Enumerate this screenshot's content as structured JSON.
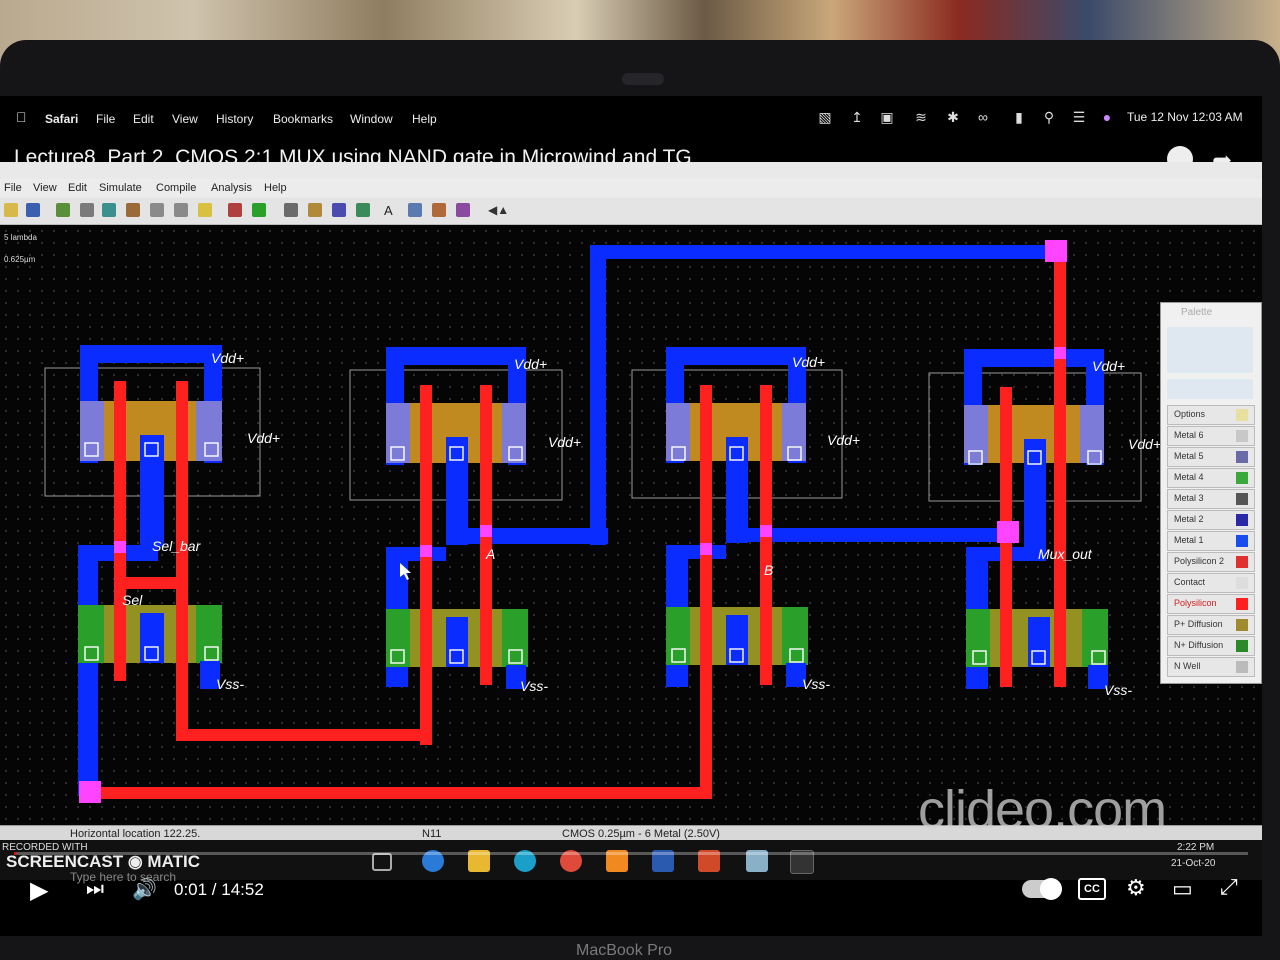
{
  "menubar": {
    "apple": "",
    "app_name": "Safari",
    "items": [
      "File",
      "Edit",
      "View",
      "History",
      "Bookmarks",
      "Window",
      "Help"
    ],
    "datetime": "Tue 12 Nov 12:03 AM"
  },
  "video": {
    "title": "Lecture8_Part 2_CMOS 2:1 MUX using NAND gate in Microwind and TG",
    "current_time": "0:01",
    "duration": "14:52",
    "time_display": "0:01 / 14:52",
    "progress_fraction": 0.001,
    "watermark": "clideo.com",
    "cc_label": "CC"
  },
  "app": {
    "menu": [
      "File",
      "View",
      "Edit",
      "Simulate",
      "Compile",
      "Analysis",
      "Help"
    ],
    "scale_top": "5 lambda",
    "scale_bottom": "0.625µm",
    "status_left": "Horizontal location 122.25.",
    "status_node": "N11",
    "status_tech": "CMOS 0.25µm - 6 Metal (2.50V)"
  },
  "palette": {
    "title": "Palette",
    "layers": [
      {
        "label": "Options",
        "color": "#e8e0a0"
      },
      {
        "label": "Metal 6",
        "color": "#c8c8c8"
      },
      {
        "label": "Metal 5",
        "color": "#6a6aa8"
      },
      {
        "label": "Metal 4",
        "color": "#3aa83a"
      },
      {
        "label": "Metal 3",
        "color": "#555555"
      },
      {
        "label": "Metal 2",
        "color": "#2a2aa8"
      },
      {
        "label": "Metal 1",
        "color": "#1a4cf0"
      },
      {
        "label": "Polysilicon 2",
        "color": "#e03030"
      },
      {
        "label": "Contact",
        "color": "#dddddd"
      },
      {
        "label": "Polysilicon",
        "color": "#ff2020"
      },
      {
        "label": "P+ Diffusion",
        "color": "#a08a30"
      },
      {
        "label": "N+ Diffusion",
        "color": "#2a8a2a"
      },
      {
        "label": "N Well",
        "color": "#bbbbbb"
      }
    ]
  },
  "layout_labels": {
    "vdd": "Vdd+",
    "vss": "Vss-",
    "sel_bar": "Sel_bar",
    "sel": "Sel",
    "a": "A",
    "b": "B",
    "mux_out": "Mux_out"
  },
  "taskbar": {
    "recorded_with": "RECORDED WITH",
    "screencast": "SCREENCAST",
    "screencast_suffix": "MATIC",
    "search_placeholder": "Type here to search",
    "tray_time": "2:22 PM",
    "tray_date": "21-Oct-20"
  },
  "device_label": "MacBook Pro",
  "colors": {
    "metal1": "#0a2cff",
    "poly": "#ff2020",
    "pdiff": "#c08a20",
    "ndiff": "#2aa02a",
    "nwell": "#7c7cd8",
    "contact_via": "#ff44ff"
  }
}
